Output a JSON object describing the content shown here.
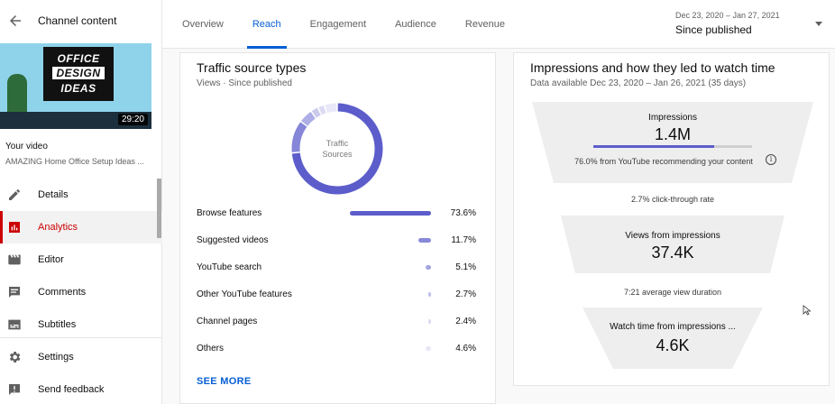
{
  "sidebar": {
    "title": "Channel content",
    "thumbnail": {
      "line1": "OFFICE",
      "line2": "DESIGN",
      "line3": "IDEAS",
      "duration": "29:20"
    },
    "your_video_label": "Your video",
    "video_title": "AMAZING Home Office Setup Ideas ...",
    "items": [
      {
        "label": "Details",
        "icon": "pencil-icon"
      },
      {
        "label": "Analytics",
        "icon": "analytics-icon",
        "active": true
      },
      {
        "label": "Editor",
        "icon": "clapper-icon"
      },
      {
        "label": "Comments",
        "icon": "comment-icon"
      },
      {
        "label": "Subtitles",
        "icon": "subtitles-icon"
      }
    ],
    "bottom_items": [
      {
        "label": "Settings",
        "icon": "gear-icon"
      },
      {
        "label": "Send feedback",
        "icon": "feedback-icon"
      }
    ],
    "accent_color": "#cc0000"
  },
  "tabs": [
    {
      "label": "Overview"
    },
    {
      "label": "Reach",
      "active": true
    },
    {
      "label": "Engagement"
    },
    {
      "label": "Audience"
    },
    {
      "label": "Revenue"
    }
  ],
  "date_range": {
    "range": "Dec 23, 2020 – Jan 27, 2021",
    "selected": "Since published"
  },
  "traffic": {
    "title": "Traffic source types",
    "subtitle": "Views · Since published",
    "donut_label_1": "Traffic",
    "donut_label_2": "Sources",
    "sources": [
      {
        "name": "Browse features",
        "pct": "73.6%",
        "value": 73.6
      },
      {
        "name": "Suggested videos",
        "pct": "11.7%",
        "value": 11.7
      },
      {
        "name": "YouTube search",
        "pct": "5.1%",
        "value": 5.1
      },
      {
        "name": "Other YouTube features",
        "pct": "2.7%",
        "value": 2.7
      },
      {
        "name": "Channel pages",
        "pct": "2.4%",
        "value": 2.4
      },
      {
        "name": "Others",
        "pct": "4.6%",
        "value": 4.6
      }
    ],
    "see_more": "SEE MORE",
    "accent_color": "#5c5dcb"
  },
  "funnel": {
    "title": "Impressions and how they led to watch time",
    "subtitle": "Data available Dec 23, 2020 – Jan 26, 2021 (35 days)",
    "impressions_label": "Impressions",
    "impressions_value": "1.4M",
    "impressions_progress": 0.76,
    "impressions_note": "76.0% from YouTube recommending your content",
    "ctr": "2.7% click-through rate",
    "views_label": "Views from impressions",
    "views_value": "37.4K",
    "avg_duration": "7:21 average view duration",
    "watch_label": "Watch time from impressions ...",
    "watch_value": "4.6K"
  }
}
